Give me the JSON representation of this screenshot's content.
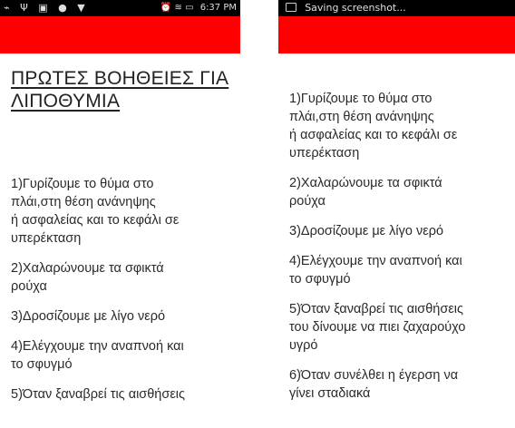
{
  "left_phone": {
    "status": {
      "icons": [
        "signal-icon",
        "usb-icon",
        "image-icon",
        "chat-icon",
        "shield-icon"
      ],
      "icon_glyphs": "⌁ Ψ ▣ ● ▼",
      "right_icons_glyphs": "⏰ ≋ ▭",
      "time": "6:37 PM"
    },
    "title": "ΠΡΩΤΕΣ ΒΟΗΘΕΙΕΣ ΓΙΑ ΛΙΠΟΘΥΜΙΑ",
    "items": [
      "1)Γυρίζουμε το θύμα στο\nπλάι,στη θέση ανάνηψης\n ή ασφαλείας και το κεφάλι σε\nυπερέκταση",
      "2)Χαλαρώνουμε τα σφικτά\nρούχα",
      "3)Δροσίζουμε με λίγο νερό",
      "4)Ελέγχουμε την αναπνοή και\nτο σφυγμό",
      "5)Όταν ξαναβρεί τις αισθήσεις"
    ]
  },
  "right_phone": {
    "status": {
      "notification": "Saving screenshot..."
    },
    "items": [
      "1)Γυρίζουμε το θύμα στο\nπλάι,στη θέση ανάνηψης\n ή ασφαλείας και το κεφάλι σε\nυπερέκταση",
      "2)Χαλαρώνουμε τα σφικτά\nρούχα",
      "3)Δροσίζουμε με λίγο νερό",
      "4)Ελέγχουμε την αναπνοή και\nτο σφυγμό",
      "5)Όταν ξαναβρεί τις αισθήσεις\nτου δίνουμε να πιει ζαχαρούχο\nυγρό",
      "6)Όταν συνέλθει η έγερση να\nγίνει σταδιακά"
    ]
  },
  "colors": {
    "appbar": "#ff0000",
    "statusbar": "#000000",
    "background": "#ffffff",
    "text": "#222222"
  }
}
